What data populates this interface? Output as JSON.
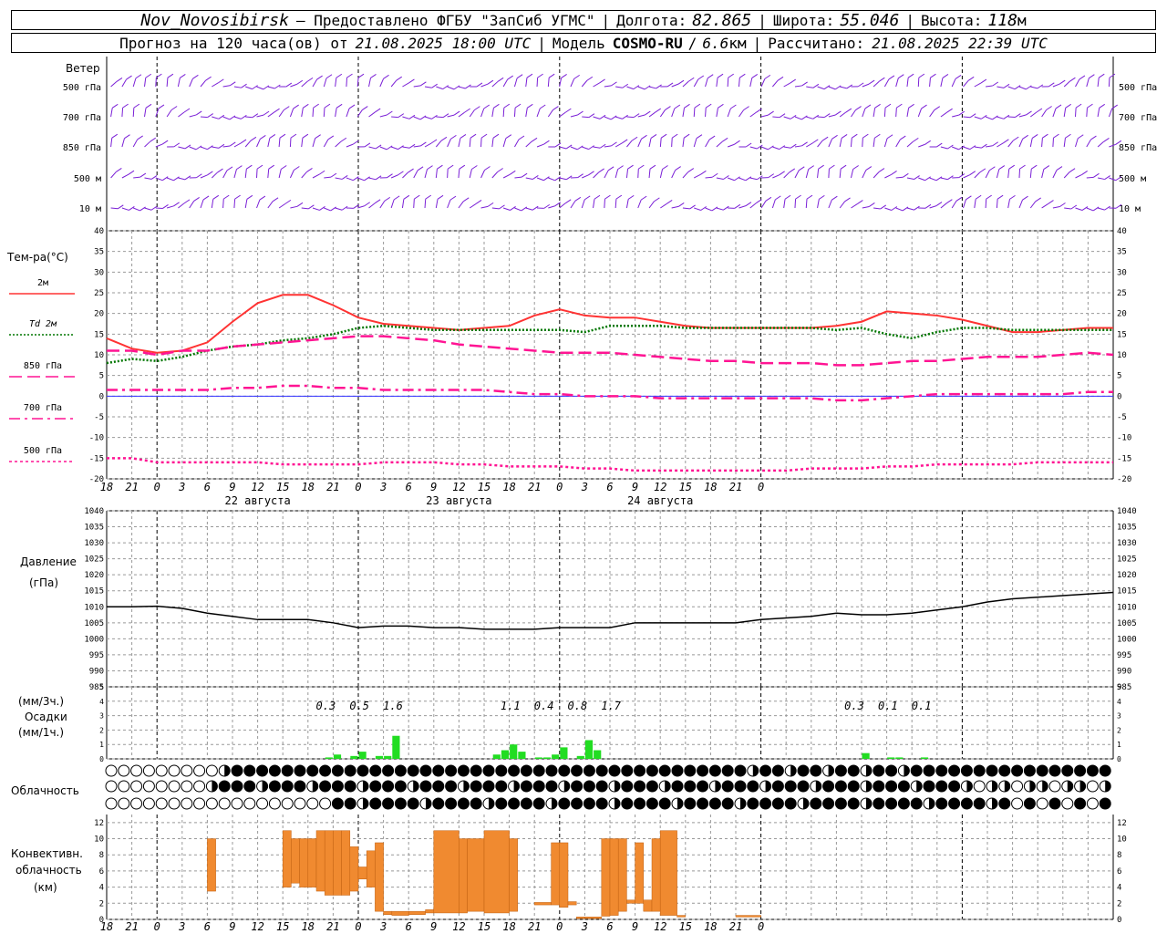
{
  "header": {
    "station": "Nov_Novosibirsk",
    "provided_by": "– Предоставлено ФГБУ \"ЗапСиб УГМС\"",
    "lon_label": "Долгота:",
    "lon": "82.865",
    "lat_label": "Широта:",
    "lat": "55.046",
    "alt_label": "Высота:",
    "alt": "118",
    "alt_unit": "м",
    "forecast_label": "Прогноз на 120 часа(ов) от",
    "forecast_time": "21.08.2025 18:00 UTC",
    "model_label": "Модель",
    "model": "COSMO-RU",
    "model_res": "6.6",
    "model_res_unit": "км",
    "calc_label": "Рассчитано:",
    "calc_time": "21.08.2025 22:39 UTC"
  },
  "time_axis": {
    "hour_labels": [
      "18",
      "21",
      "0",
      "3",
      "6",
      "9",
      "12",
      "15",
      "18",
      "21",
      "0",
      "3",
      "6",
      "9",
      "12",
      "15",
      "18",
      "21",
      "0",
      "3",
      "6",
      "9",
      "12",
      "15",
      "18",
      "21",
      "0"
    ],
    "date_labels": [
      "22 августа",
      "23 августа",
      "24 августа"
    ]
  },
  "wind_panel": {
    "title": "Ветер",
    "levels": [
      "500 гПа",
      "700 гПа",
      "850 гПа",
      "500 м",
      "10  м"
    ]
  },
  "temp_panel": {
    "title": "Тем-ра(°C)",
    "legend": [
      {
        "label": "2м",
        "color": "#ff3333",
        "style": "solid"
      },
      {
        "label": "Td  2м",
        "color": "#007700",
        "style": "dotted"
      },
      {
        "label": "850 гПа",
        "color": "#ff1493",
        "style": "dashed"
      },
      {
        "label": "700 гПа",
        "color": "#ff1493",
        "style": "dashdot"
      },
      {
        "label": "500 гПа",
        "color": "#ff1493",
        "style": "dotted"
      }
    ],
    "yticks": [
      "40",
      "35",
      "30",
      "25",
      "20",
      "15",
      "10",
      "5",
      "0",
      "-5",
      "-10",
      "-15",
      "-20"
    ]
  },
  "pressure_panel": {
    "title": "Давление",
    "unit": "(гПа)",
    "yticks": [
      "1040",
      "1035",
      "1030",
      "1025",
      "1020",
      "1015",
      "1010",
      "1005",
      "1000",
      "995",
      "990",
      "985"
    ]
  },
  "precip_panel": {
    "unit3": "(мм/3ч.)",
    "title": "Осадки",
    "unit1": "(мм/1ч.)",
    "yticks": [
      "5",
      "4",
      "3",
      "2",
      "1",
      "0"
    ],
    "totals": [
      "0.3",
      "0.5",
      "1.6",
      "1.1",
      "0.4",
      "0.8",
      "1.7",
      "0.3",
      "0.1",
      "0.1"
    ]
  },
  "cloud_panel": {
    "title": "Облачность"
  },
  "conv_panel": {
    "title1": "Конвективн.",
    "title2": "облачность",
    "unit": "(км)",
    "yticks": [
      "12",
      "10",
      "8",
      "6",
      "4",
      "2",
      "0"
    ]
  },
  "colors": {
    "t2m": "#ff3333",
    "td2m": "#007700",
    "upper": "#ff1493",
    "wind": "#7a1fd6",
    "pressure": "#000000",
    "precip": "#22dd22",
    "convective": "#f08a30",
    "zero_line": "#3333ff"
  },
  "chart_data": [
    {
      "type": "line",
      "title": "Тем-ра(°C)",
      "x": [
        -6,
        -3,
        0,
        3,
        6,
        9,
        12,
        15,
        18,
        21,
        24,
        27,
        30,
        33,
        36,
        39,
        42,
        45,
        48,
        51,
        54,
        57,
        60,
        63,
        66,
        69,
        72,
        75,
        78,
        81,
        84,
        87,
        90,
        93,
        96,
        99,
        102,
        105,
        108,
        111,
        114
      ],
      "ylim": [
        -20,
        40
      ],
      "series": [
        {
          "name": "2м",
          "values": [
            14,
            11.5,
            10.5,
            11,
            13,
            18,
            22.5,
            24.5,
            24.5,
            22,
            19,
            17.5,
            17,
            16.5,
            16,
            16.5,
            17,
            19.5,
            21,
            19.5,
            19,
            19,
            18,
            17,
            16.5,
            16.5,
            16.5,
            16.5,
            16.5,
            17,
            18,
            20.5,
            20,
            19.5,
            18.5,
            17,
            15.5,
            15.5,
            16,
            16.5,
            16.5
          ]
        },
        {
          "name": "Td  2м",
          "values": [
            8,
            9,
            8.5,
            9.5,
            11,
            12,
            12.5,
            13.5,
            14,
            15,
            16.5,
            17,
            16.5,
            16,
            16,
            16,
            16,
            16,
            16,
            15.5,
            17,
            17,
            17,
            16.5,
            16.5,
            16.5,
            16.5,
            16.5,
            16.5,
            16,
            16.5,
            15,
            14,
            15.5,
            16.5,
            16.5,
            16,
            16,
            16,
            16,
            16
          ]
        },
        {
          "name": "850 гПа",
          "values": [
            11,
            11,
            10,
            11,
            11,
            12,
            12.5,
            13,
            13.5,
            14,
            14.5,
            14.5,
            14,
            13.5,
            12.5,
            12,
            11.5,
            11,
            10.5,
            10.5,
            10.5,
            10,
            9.5,
            9,
            8.5,
            8.5,
            8,
            8,
            8,
            7.5,
            7.5,
            8,
            8.5,
            8.5,
            9,
            9.5,
            9.5,
            9.5,
            10,
            10.5,
            10
          ]
        },
        {
          "name": "700 гПа",
          "values": [
            1.5,
            1.5,
            1.5,
            1.5,
            1.5,
            2,
            2,
            2.5,
            2.5,
            2,
            2,
            1.5,
            1.5,
            1.5,
            1.5,
            1.5,
            1,
            0.5,
            0.5,
            0,
            0,
            0,
            -0.5,
            -0.5,
            -0.5,
            -0.5,
            -0.5,
            -0.5,
            -0.5,
            -1,
            -1,
            -0.5,
            0,
            0.5,
            0.5,
            0.5,
            0.5,
            0.5,
            0.5,
            1,
            1
          ]
        },
        {
          "name": "500 гПа",
          "values": [
            -15,
            -15,
            -16,
            -16,
            -16,
            -16,
            -16,
            -16.5,
            -16.5,
            -16.5,
            -16.5,
            -16,
            -16,
            -16,
            -16.5,
            -16.5,
            -17,
            -17,
            -17,
            -17.5,
            -17.5,
            -18,
            -18,
            -18,
            -18,
            -18,
            -18,
            -18,
            -17.5,
            -17.5,
            -17.5,
            -17,
            -17,
            -16.5,
            -16.5,
            -16.5,
            -16.5,
            -16,
            -16,
            -16,
            -16
          ]
        }
      ]
    },
    {
      "type": "line",
      "title": "Давление",
      "ylabel": "(гПа)",
      "ylim": [
        985,
        1040
      ],
      "x": [
        -6,
        -3,
        0,
        3,
        6,
        9,
        12,
        15,
        18,
        21,
        24,
        27,
        30,
        33,
        36,
        39,
        42,
        45,
        48,
        51,
        54,
        57,
        60,
        63,
        66,
        69,
        72,
        75,
        78,
        81,
        84,
        87,
        90,
        93,
        96,
        99,
        102,
        105,
        108,
        111,
        114
      ],
      "series": [
        {
          "name": "",
          "values": [
            1010,
            1010,
            1010.2,
            1009.5,
            1008,
            1007,
            1006,
            1006,
            1006,
            1005,
            1003.5,
            1004,
            1004,
            1003.5,
            1003.5,
            1003,
            1003,
            1003,
            1003.5,
            1003.5,
            1003.5,
            1005,
            1005,
            1005,
            1005,
            1005,
            1006,
            1006.5,
            1007,
            1008,
            1007.5,
            1007.5,
            1008,
            1009,
            1010,
            1011.5,
            1012.5,
            1013,
            1013.5,
            1014,
            1014.5
          ]
        }
      ]
    },
    {
      "type": "bar",
      "title": "Осадки",
      "ylabel": "(мм/1ч.)",
      "ylim": [
        0,
        5
      ],
      "x": [
        21,
        22,
        23,
        24,
        25,
        26,
        27,
        28,
        29,
        30,
        31,
        32,
        33,
        34,
        35,
        36,
        37,
        38,
        39,
        40,
        41,
        42,
        43,
        44,
        45,
        46,
        47,
        48,
        49,
        50,
        51,
        52,
        53,
        54,
        55,
        56,
        57,
        58,
        59,
        60,
        61,
        62,
        63,
        64,
        65,
        66,
        67,
        68,
        69,
        70,
        71,
        72,
        73,
        74,
        75,
        76,
        77,
        78,
        79,
        80,
        81,
        82,
        83,
        84,
        85,
        86,
        87,
        88,
        89,
        90,
        91,
        92,
        93,
        94,
        95,
        96,
        97,
        98,
        99,
        100,
        101,
        102,
        103,
        104,
        105,
        106,
        107,
        108,
        109,
        110,
        111,
        112,
        113,
        114
      ],
      "values": [
        0.1,
        0.3,
        0,
        0.2,
        0.5,
        0,
        0.2,
        0.2,
        1.6,
        0,
        0,
        0,
        0,
        0,
        0,
        0,
        0,
        0,
        0,
        0,
        0.3,
        0.6,
        1.0,
        0.5,
        0,
        0.1,
        0.1,
        0.3,
        0.8,
        0,
        0.2,
        1.3,
        0.6,
        0,
        0,
        0,
        0,
        0,
        0,
        0,
        0,
        0,
        0,
        0,
        0,
        0,
        0,
        0,
        0,
        0,
        0,
        0,
        0,
        0,
        0,
        0,
        0,
        0,
        0,
        0,
        0,
        0,
        0,
        0,
        0.4,
        0,
        0,
        0.1,
        0.1,
        0,
        0,
        0.1,
        0,
        0,
        0,
        0,
        0,
        0,
        0,
        0,
        0,
        0,
        0,
        0,
        0,
        0,
        0,
        0,
        0,
        0,
        0,
        0,
        0,
        0
      ]
    },
    {
      "type": "bar",
      "title": "Конвективн. облачность",
      "ylabel": "(км)",
      "ylim": [
        0,
        13
      ],
      "bars": [
        {
          "x0": 6,
          "x1": 7,
          "low": 3.5,
          "high": 10
        },
        {
          "x0": 15,
          "x1": 16,
          "low": 4,
          "high": 11
        },
        {
          "x0": 16,
          "x1": 17,
          "low": 4.5,
          "high": 10
        },
        {
          "x0": 17,
          "x1": 18,
          "low": 4,
          "high": 10
        },
        {
          "x0": 18,
          "x1": 19,
          "low": 4,
          "high": 10
        },
        {
          "x0": 19,
          "x1": 20,
          "low": 3.5,
          "high": 11
        },
        {
          "x0": 20,
          "x1": 21,
          "low": 3,
          "high": 11
        },
        {
          "x0": 21,
          "x1": 22,
          "low": 3,
          "high": 11
        },
        {
          "x0": 22,
          "x1": 23,
          "low": 3,
          "high": 11
        },
        {
          "x0": 23,
          "x1": 24,
          "low": 3.5,
          "high": 9
        },
        {
          "x0": 24,
          "x1": 25,
          "low": 5,
          "high": 6.5
        },
        {
          "x0": 25,
          "x1": 26,
          "low": 4,
          "high": 8.5
        },
        {
          "x0": 26,
          "x1": 27,
          "low": 1,
          "high": 9.5
        },
        {
          "x0": 27,
          "x1": 28,
          "low": 0.6,
          "high": 1
        },
        {
          "x0": 28,
          "x1": 30,
          "low": 0.5,
          "high": 1
        },
        {
          "x0": 30,
          "x1": 32,
          "low": 0.6,
          "high": 1
        },
        {
          "x0": 32,
          "x1": 33,
          "low": 0.8,
          "high": 1.2
        },
        {
          "x0": 33,
          "x1": 36,
          "low": 0.8,
          "high": 11
        },
        {
          "x0": 36,
          "x1": 37,
          "low": 0.8,
          "high": 10
        },
        {
          "x0": 37,
          "x1": 39,
          "low": 1,
          "high": 10
        },
        {
          "x0": 39,
          "x1": 42,
          "low": 0.8,
          "high": 11
        },
        {
          "x0": 42,
          "x1": 43,
          "low": 1,
          "high": 10
        },
        {
          "x0": 45,
          "x1": 47,
          "low": 1.8,
          "high": 2.1
        },
        {
          "x0": 47,
          "x1": 48,
          "low": 1.8,
          "high": 9.5
        },
        {
          "x0": 48,
          "x1": 49,
          "low": 1.5,
          "high": 9.5
        },
        {
          "x0": 49,
          "x1": 50,
          "low": 1.8,
          "high": 2.2
        },
        {
          "x0": 50,
          "x1": 51,
          "low": 0.1,
          "high": 0.3
        },
        {
          "x0": 51,
          "x1": 53,
          "low": 0.1,
          "high": 0.3
        },
        {
          "x0": 53,
          "x1": 54,
          "low": 0.4,
          "high": 10
        },
        {
          "x0": 54,
          "x1": 55,
          "low": 0.5,
          "high": 10
        },
        {
          "x0": 55,
          "x1": 56,
          "low": 1,
          "high": 10
        },
        {
          "x0": 56,
          "x1": 57,
          "low": 2,
          "high": 2.4
        },
        {
          "x0": 57,
          "x1": 58,
          "low": 2,
          "high": 9.5
        },
        {
          "x0": 58,
          "x1": 59,
          "low": 1,
          "high": 2.4
        },
        {
          "x0": 59,
          "x1": 60,
          "low": 1,
          "high": 10
        },
        {
          "x0": 60,
          "x1": 62,
          "low": 0.5,
          "high": 11
        },
        {
          "x0": 62,
          "x1": 63,
          "low": 0.3,
          "high": 0.5
        },
        {
          "x0": 69,
          "x1": 72,
          "low": 0.3,
          "high": 0.5
        }
      ]
    }
  ]
}
